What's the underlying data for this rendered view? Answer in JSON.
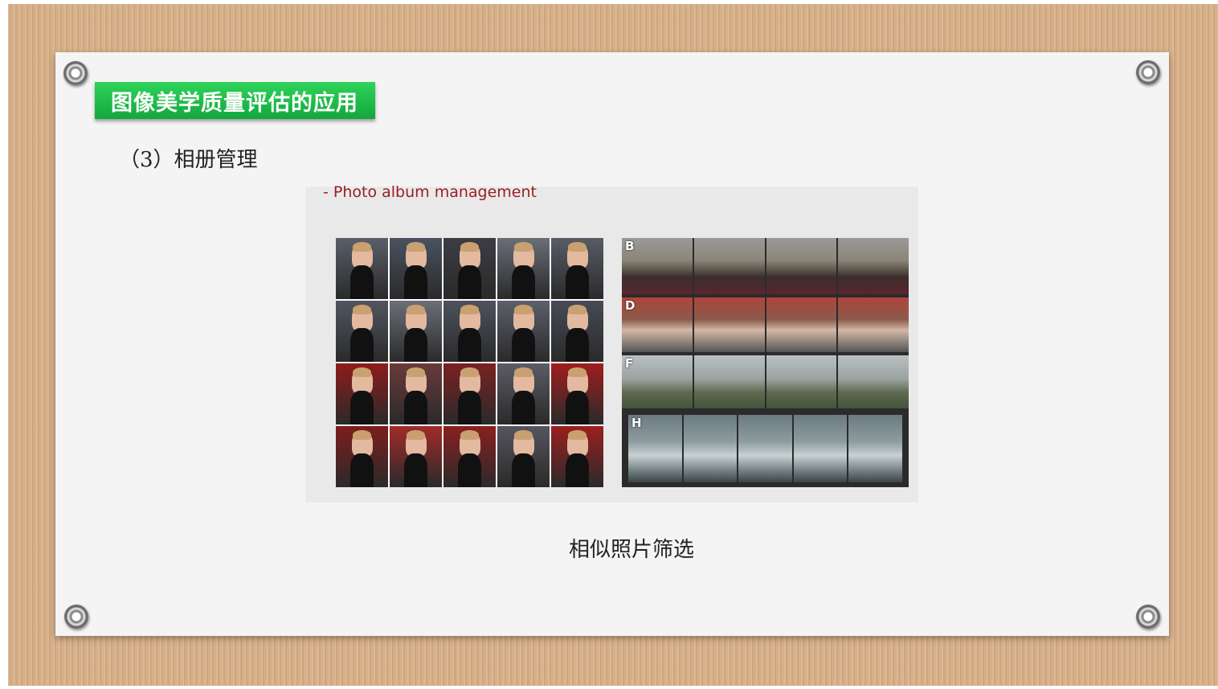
{
  "slide": {
    "title": "图像美学质量评估的应用",
    "subtitle": "（3）相册管理",
    "figure_caption": "- Photo album management",
    "bottom_caption": "相似照片筛选"
  },
  "strips": [
    {
      "label": "B",
      "kind": "crowd"
    },
    {
      "label": "D",
      "kind": "selfie"
    },
    {
      "label": "F",
      "kind": "landscape"
    },
    {
      "label": "H",
      "kind": "beach"
    }
  ],
  "colors": {
    "title_green": "#13a73c",
    "caption_red": "#9a1f24",
    "board": "#d7b089",
    "paper": "#f4f4f4"
  }
}
